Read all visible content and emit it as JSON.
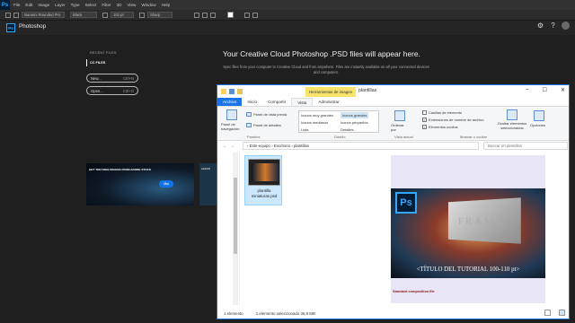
{
  "photoshop": {
    "logo": "Ps",
    "menu": [
      "File",
      "Edit",
      "Image",
      "Layer",
      "Type",
      "Select",
      "Filter",
      "3D",
      "View",
      "Window",
      "Help"
    ],
    "options": {
      "font_family": "Nanami Rounded Pro",
      "font_style": "Black",
      "font_size": "102 pt",
      "anti_alias": "Sharp"
    },
    "home": {
      "badge": "Ps",
      "title": "Photoshop",
      "recent_files": "RECENT FILES",
      "cc_files": "CC FILES",
      "new_label": "New...",
      "new_shortcut": "Ctrl+N",
      "open_label": "Open...",
      "open_shortcut": "Ctrl+O",
      "headline": "Your Creative Cloud Photoshop .PSD files will appear here.",
      "sub": "Sync files from your computer to Creative Cloud and from anywhere. Files are instantly available on all your connected devices and computers.",
      "stock_text": "GET TEN FREE IMAGES FROM ADOBE STOCK",
      "stock_go": "Go",
      "stock2_text": "LEARN"
    }
  },
  "explorer": {
    "ctx_tab": "Herramientas de imagen",
    "title": "plantillas",
    "tabs": [
      "Archivo",
      "Inicio",
      "Compartir",
      "Vista",
      "Administrar"
    ],
    "ribbon": {
      "nav_pane": "Panel de navegación",
      "preview_pane": "Panel de vista previa",
      "details_pane": "Panel de detalles",
      "panes_label": "Paneles",
      "layout": [
        "Iconos muy grandes",
        "Iconos grandes",
        "Iconos medianos",
        "Iconos pequeños",
        "Lista",
        "Detalles"
      ],
      "layout_label": "Diseño",
      "sort": "Ordenar por",
      "view_label": "Vista actual",
      "checks": [
        "Casillas de elemento",
        "Extensiones de nombre de archivo",
        "Elementos ocultos"
      ],
      "hide": "Ocultar elementos seleccionados",
      "show_label": "Mostrar u ocultar",
      "options": "Opciones"
    },
    "path": "›  Este equipo  ›  Escritorio  ›  plantillas",
    "search_placeholder": "Buscar en plantillas",
    "file": {
      "name": "plantilla miniaturas.psd"
    },
    "preview": {
      "caption": "<TÍTULO DEL TUTORIAL 100-110 pt>",
      "frame": "FRAME",
      "ps": "Ps",
      "standard": "Standard composition file"
    },
    "status": {
      "count": "1 elemento",
      "selected": "1 elemento seleccionado  36,9 MB"
    }
  }
}
